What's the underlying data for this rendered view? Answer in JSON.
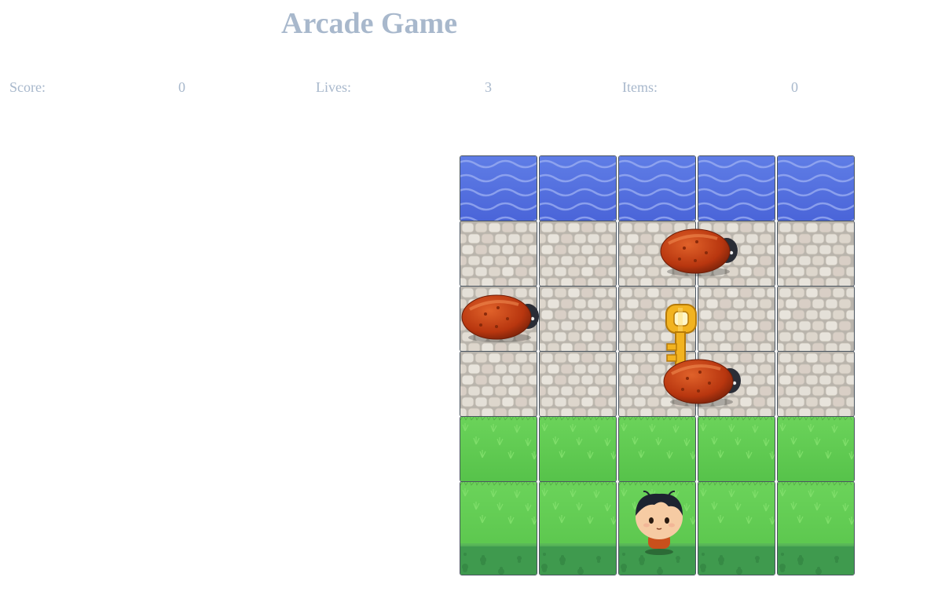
{
  "header": {
    "title": "Arcade Game"
  },
  "stats": {
    "score_label": "Score:",
    "score_value": "0",
    "lives_label": "Lives:",
    "lives_value": "3",
    "items_label": "Items:",
    "items_value": "0"
  },
  "board": {
    "columns": 5,
    "rows": [
      "water",
      "stone",
      "stone",
      "stone",
      "grass",
      "grass"
    ],
    "colors": {
      "water": "#4a64d8",
      "stone": "#d8d4cc",
      "grass": "#56c24a",
      "ground": "#3f9a4e",
      "title_text": "#a8b8cc"
    },
    "enemies": [
      "enemy-bug",
      "enemy-bug",
      "enemy-bug"
    ],
    "collectible": "key-icon",
    "player": "player-boy"
  }
}
